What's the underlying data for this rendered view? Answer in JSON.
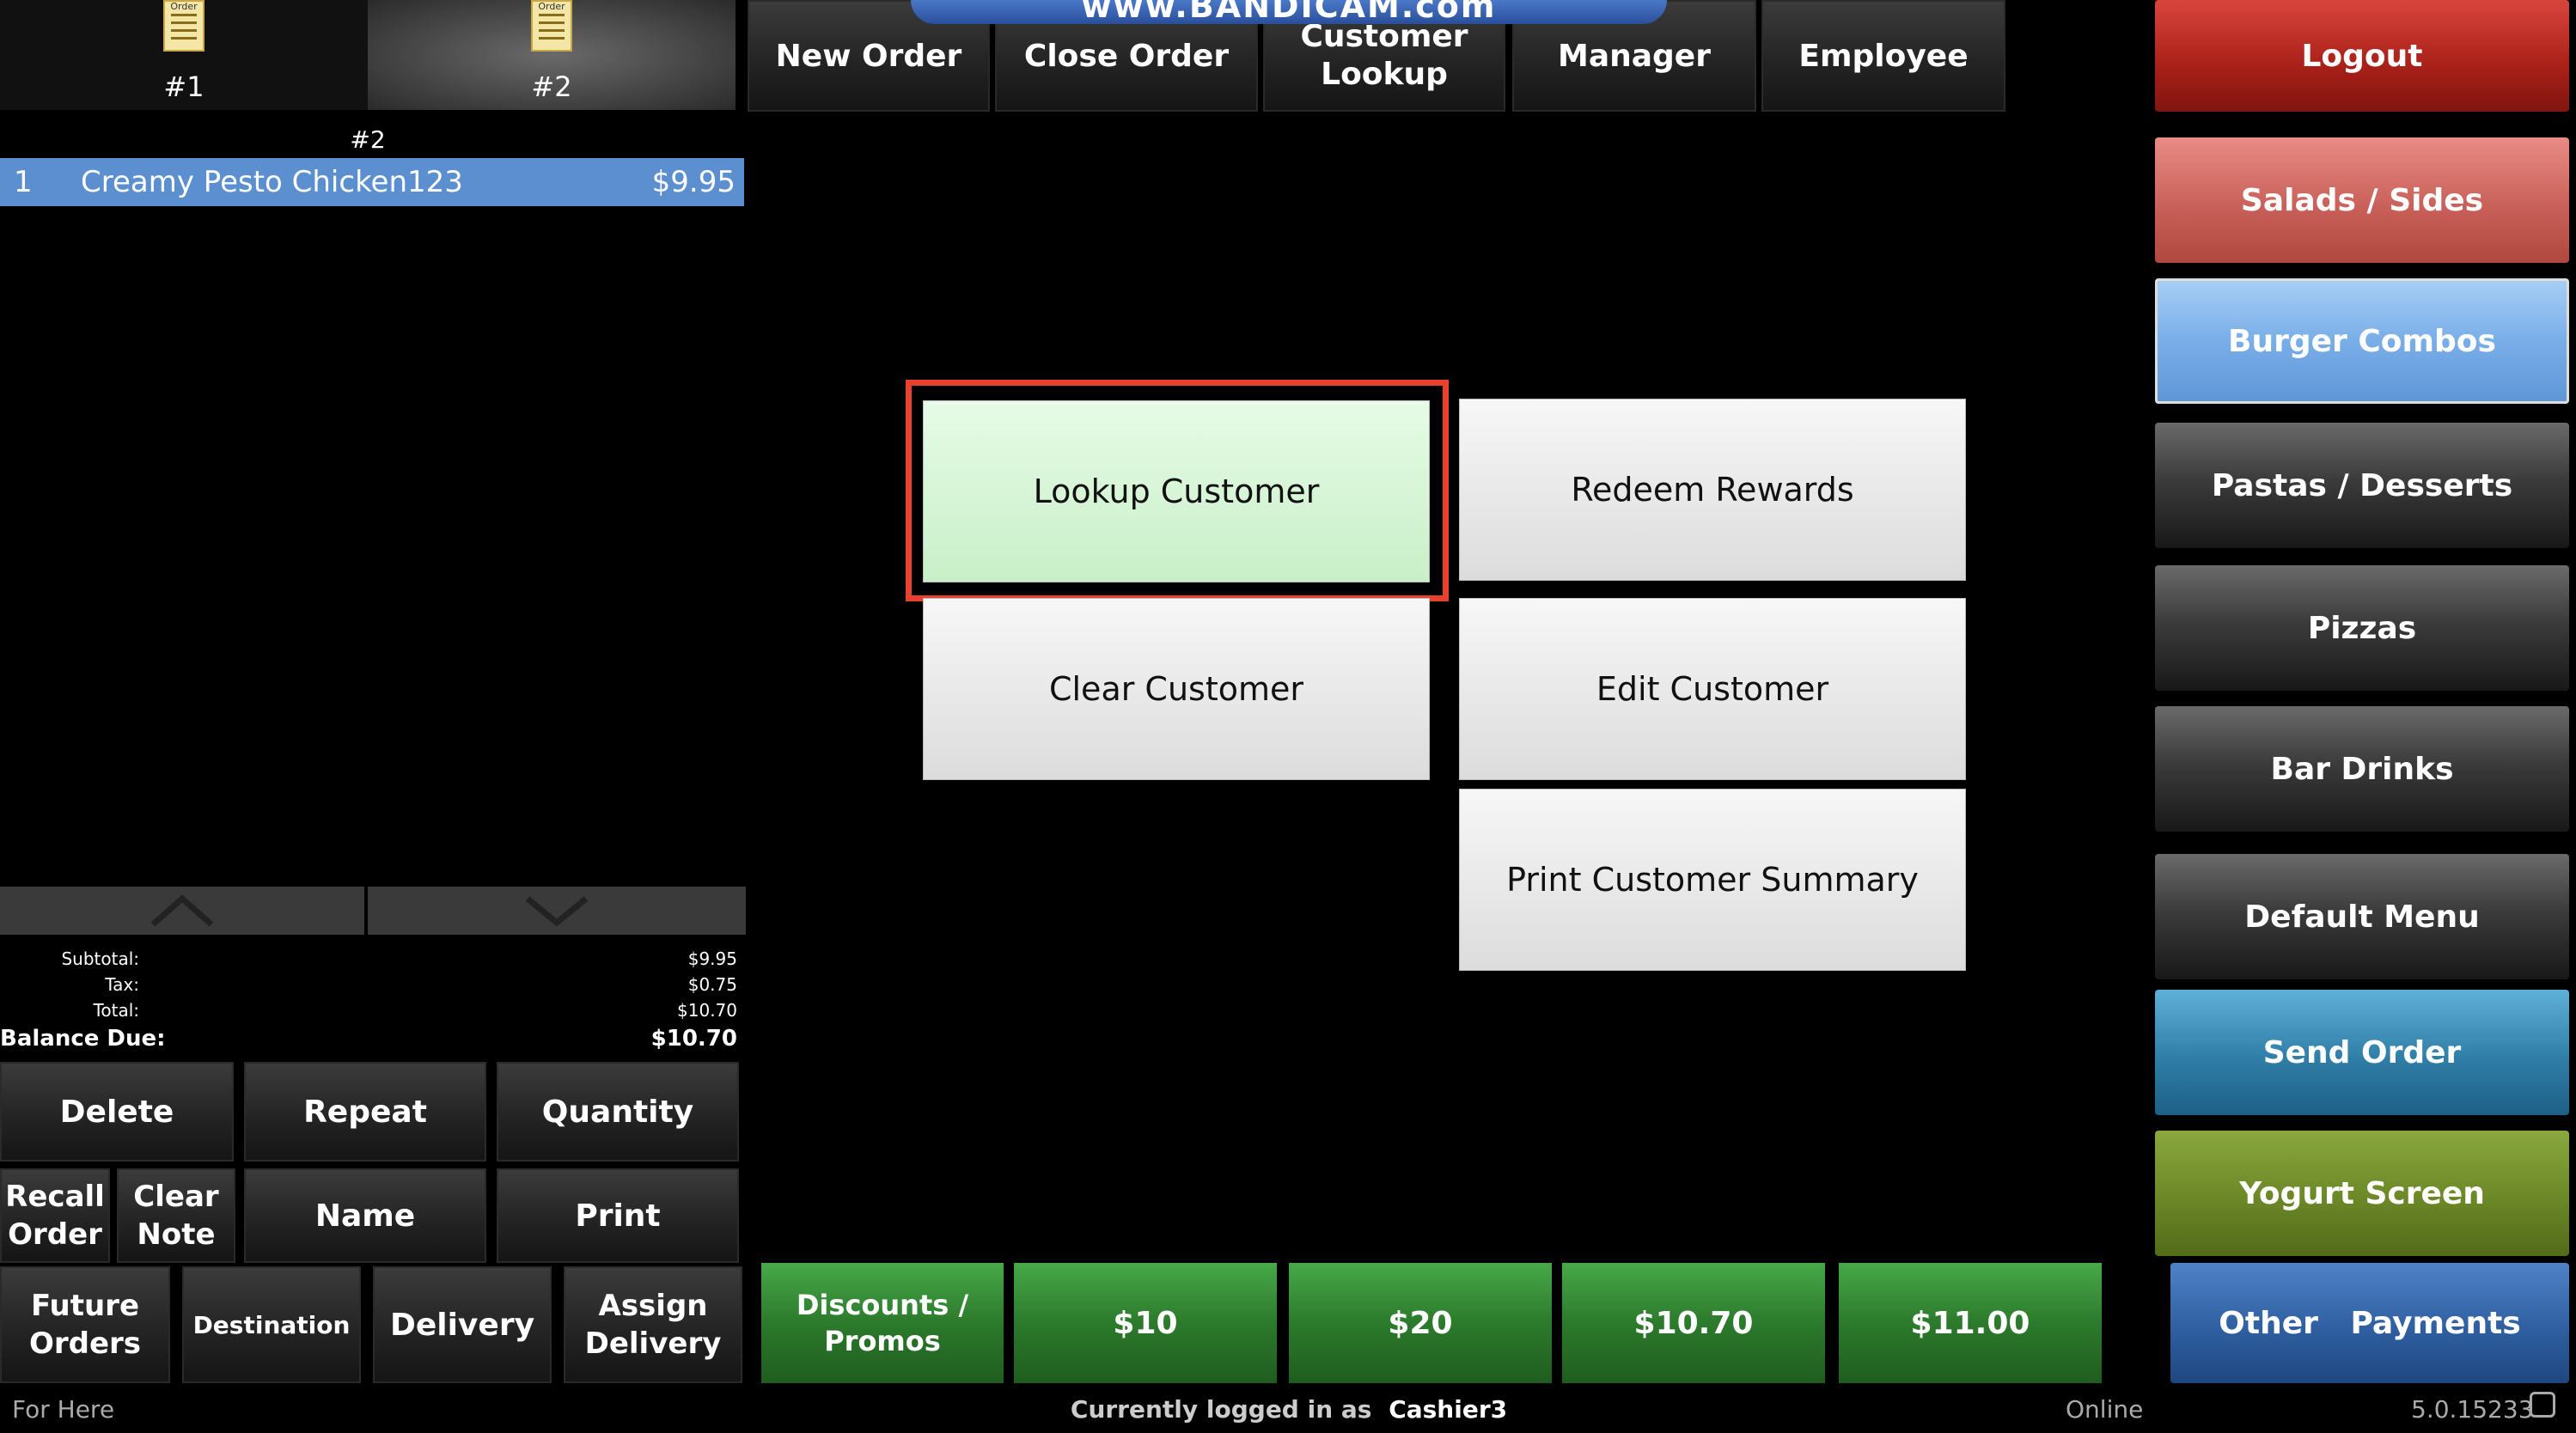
{
  "order_tabs": [
    {
      "label": "#1"
    },
    {
      "label": "#2"
    }
  ],
  "order": {
    "header": "#2",
    "items": [
      {
        "qty": "1",
        "name": "Creamy Pesto Chicken123",
        "price": "$9.95"
      }
    ]
  },
  "top_buttons": {
    "new_order": "New Order",
    "close_order": "Close Order",
    "customer_lookup": "Customer Lookup",
    "manager": "Manager",
    "employee": "Employee"
  },
  "watermark": "www.BANDICAM.com",
  "right_menu": {
    "logout": "Logout",
    "salads_sides": "Salads / Sides",
    "burger_combos": "Burger Combos",
    "pastas_desserts": "Pastas / Desserts",
    "pizzas": "Pizzas",
    "bar_drinks": "Bar Drinks",
    "default_menu": "Default Menu",
    "send_order": "Send Order",
    "yogurt_screen": "Yogurt Screen",
    "other_payments": "Other   Payments"
  },
  "customer_popup": {
    "lookup_customer": "Lookup Customer",
    "redeem_rewards": "Redeem Rewards",
    "clear_customer": "Clear Customer",
    "edit_customer": "Edit Customer",
    "print_customer_summary": "Print Customer Summary"
  },
  "totals": {
    "subtotal_label": "Subtotal:",
    "subtotal": "$9.95",
    "tax_label": "Tax:",
    "tax": "$0.75",
    "total_label": "Total:",
    "total": "$10.70",
    "balance_label": "Balance Due:",
    "balance": "$10.70"
  },
  "action_buttons": {
    "delete": "Delete",
    "repeat": "Repeat",
    "quantity": "Quantity",
    "recall_order": "Recall Order",
    "clear_note": "Clear Note",
    "name": "Name",
    "print": "Print",
    "future_orders": "Future Orders",
    "destination": "Destination",
    "delivery": "Delivery",
    "assign_delivery": "Assign Delivery"
  },
  "payment_buttons": {
    "discounts": "Discounts / Promos",
    "ten": "$10",
    "twenty": "$20",
    "exact": "$10.70",
    "eleven": "$11.00"
  },
  "status_bar": {
    "order_type": "For Here",
    "logged_in_prefix": "Currently logged in as",
    "user": "Cashier3",
    "connection": "Online",
    "version": "5.0.15233"
  },
  "colors": {
    "logout": "#b12820",
    "salads": "#c9615a",
    "burger_combos": "#79aee8",
    "send_order": "#2f7ea8",
    "yogurt": "#6b8727",
    "other_payments": "#2f5fa0",
    "lookup_highlight": "#d6f6d6",
    "selection_border": "#e8422f",
    "order_row": "#5b8fd0"
  }
}
